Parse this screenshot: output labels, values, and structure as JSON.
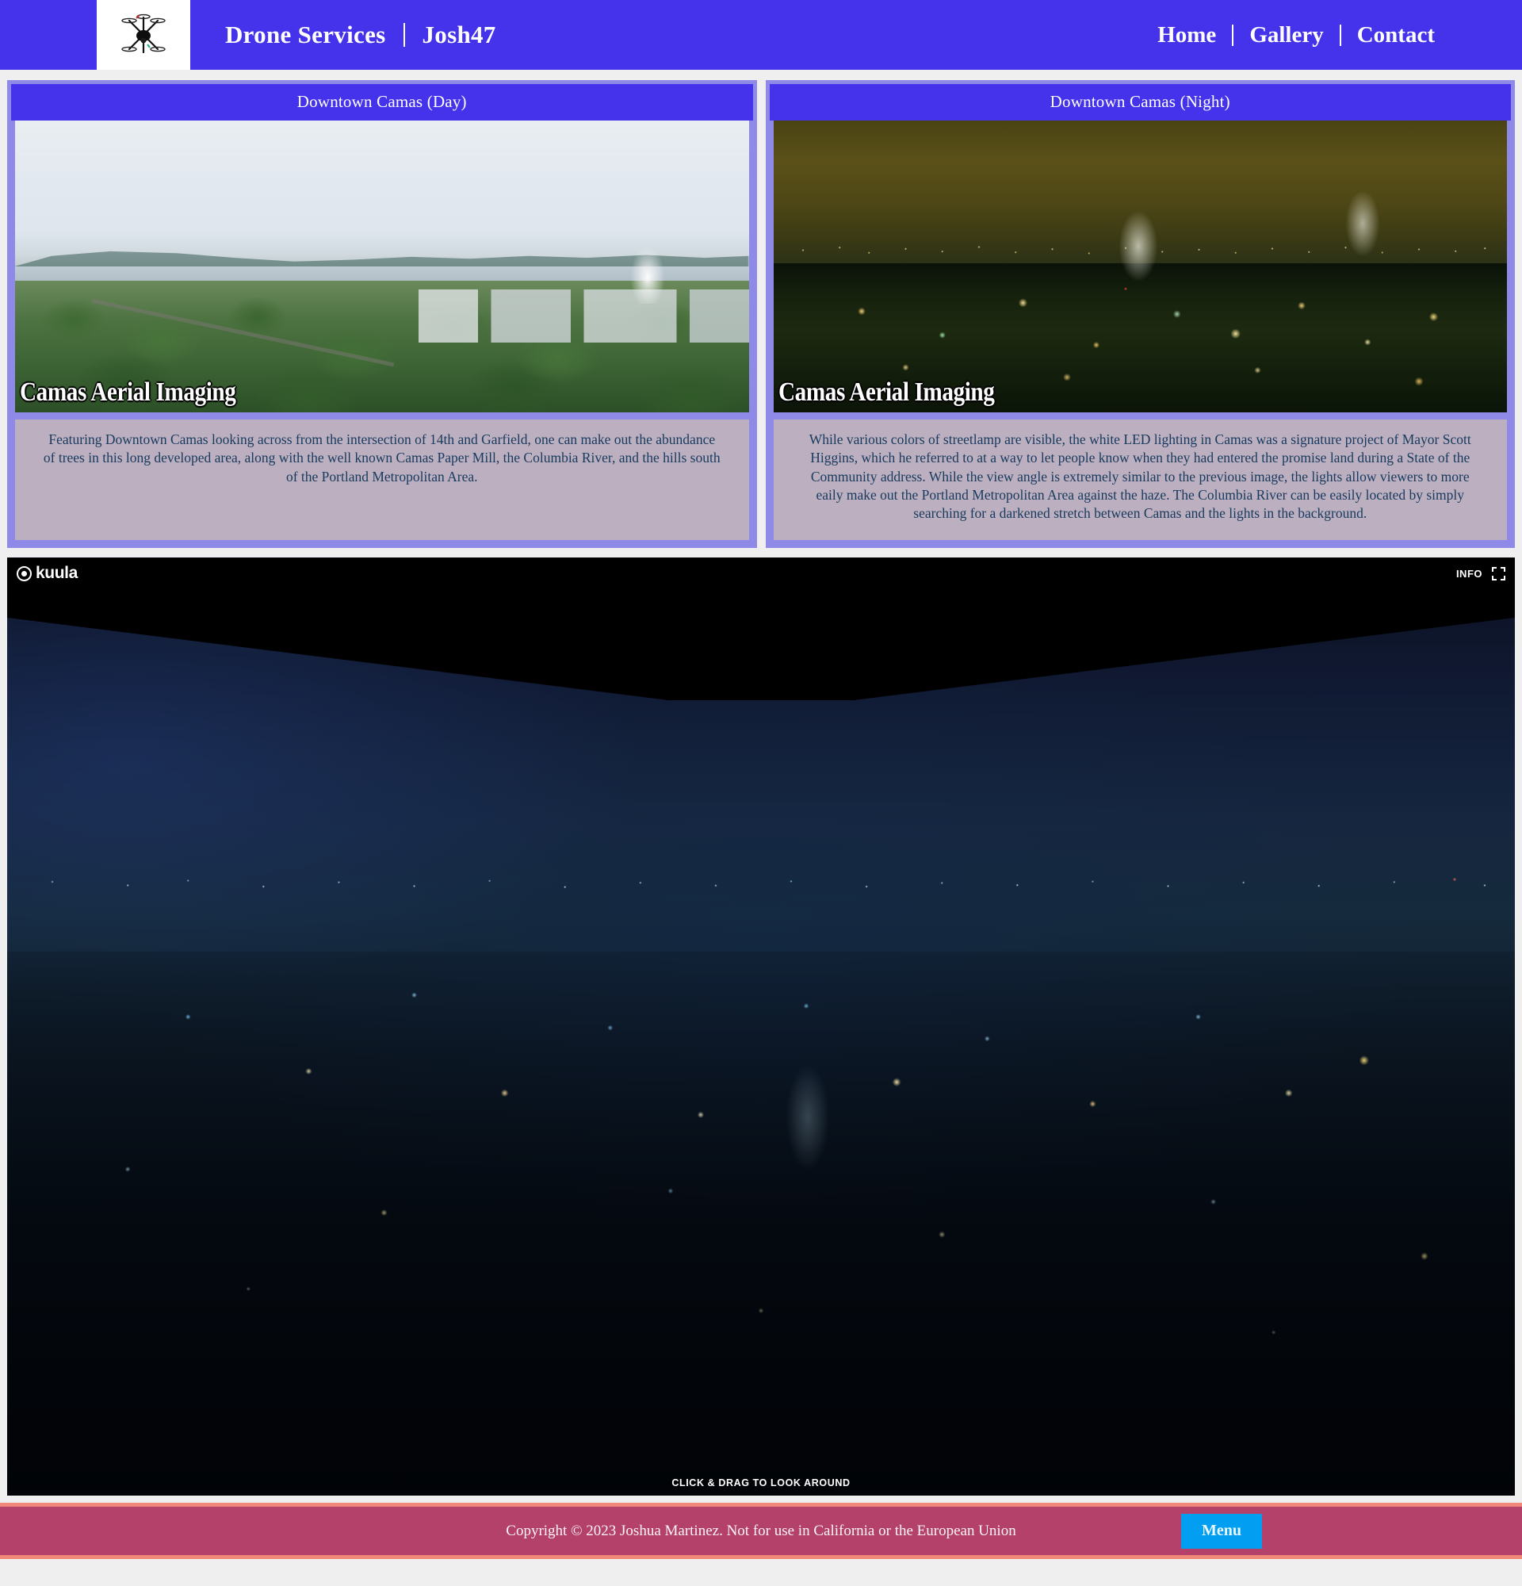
{
  "header": {
    "logo_icon": "drone-icon",
    "brand_title": "Drone Services",
    "brand_sub": "Josh47",
    "nav": [
      {
        "label": "Home"
      },
      {
        "label": "Gallery"
      },
      {
        "label": "Contact"
      }
    ],
    "accent_color": "#4433ea"
  },
  "cards": [
    {
      "title": "Downtown Camas (Day)",
      "watermark": "Camas Aerial Imaging",
      "caption": "Featuring Downtown Camas looking across from the intersection of 14th and Garfield, one can make out the abundance of trees in this long developed area, along with the well known Camas Paper Mill, the Columbia River, and the hills south of the Portland Metropolitan Area."
    },
    {
      "title": "Downtown Camas (Night)",
      "watermark": "Camas Aerial Imaging",
      "caption": "While various colors of streetlamp are visible, the white LED lighting in Camas was a signature project of Mayor Scott Higgins, which he referred to at a way to let people know when they had entered the promise land during a State of the Community address. While the view angle is extremely similar to the previous image, the lights allow viewers to more eaily make out the Portland Metropolitan Area against the haze. The Columbia River can be easily located by simply searching for a darkened stretch between Camas and the lights in the background."
    }
  ],
  "panorama": {
    "provider": "kuula",
    "info_label": "INFO",
    "fullscreen_icon": "fullscreen-icon",
    "hint": "CLICK & DRAG TO LOOK AROUND"
  },
  "footer": {
    "copyright": "Copyright © 2023 Joshua Martinez. Not for use in California or the European Union",
    "menu_label": "Menu",
    "menu_color": "#029ef2",
    "background_color": "#b34169"
  }
}
